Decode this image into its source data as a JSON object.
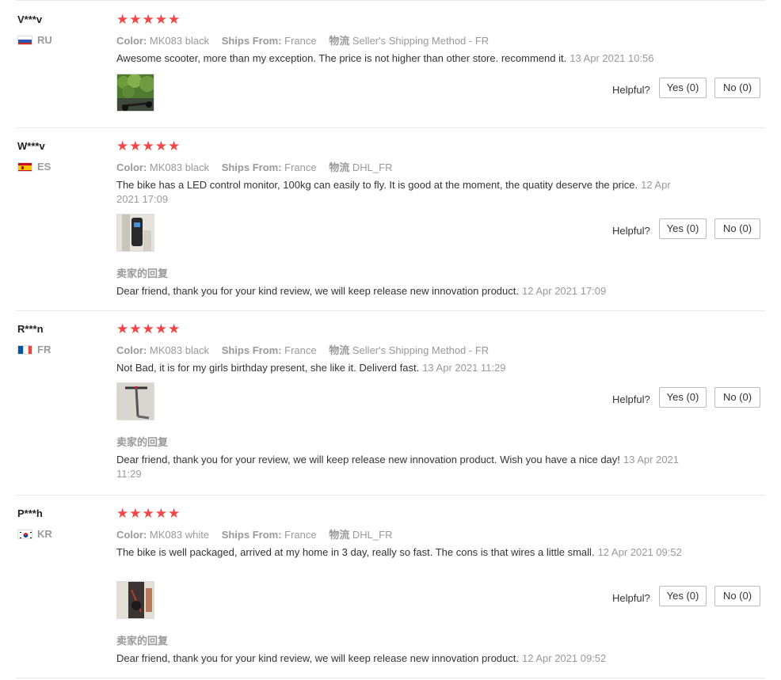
{
  "labels": {
    "color": "Color:",
    "ships_from": "Ships From:",
    "logistics": "物流",
    "helpful": "Helpful?",
    "yes": "Yes (0)",
    "no": "No (0)",
    "seller_reply_title": "卖家的回复"
  },
  "rating_stars": "★★★★★",
  "reviews": [
    {
      "user": "V***v",
      "country": "RU",
      "flag_icon": "russia-flag-icon",
      "color_value": "MK083 black",
      "ships_from_value": "France",
      "logistics_value": "Seller's Shipping Method - FR",
      "text": "Awesome scooter, more than my exception. The price is not higher than other store. recommend it.",
      "date": "13 Apr 2021 10:56"
    },
    {
      "user": "W***v",
      "country": "ES",
      "flag_icon": "spain-flag-icon",
      "color_value": "MK083 black",
      "ships_from_value": "France",
      "logistics_value": "DHL_FR",
      "text": "The bike has a LED control monitor, 100kg can easily to fly. It is good at the moment, the quatity deserve the price.",
      "date": "12 Apr 2021 17:09",
      "reply_text": "Dear friend, thank you for your kind review, we will keep release new innovation product.",
      "reply_date": "12 Apr 2021 17:09"
    },
    {
      "user": "R***n",
      "country": "FR",
      "flag_icon": "france-flag-icon",
      "color_value": "MK083 black",
      "ships_from_value": "France",
      "logistics_value": "Seller's Shipping Method - FR",
      "text": "Not Bad, it is for my girls birthday present, she like it. Deliverd fast.",
      "date": "13 Apr 2021 11:29",
      "reply_text": "Dear friend, thank you for your review, we will keep release new innovation product. Wish you have a nice day!",
      "reply_date": "13 Apr 2021 11:29"
    },
    {
      "user": "P***h",
      "country": "KR",
      "flag_icon": "south-korea-flag-icon",
      "color_value": "MK083 white",
      "ships_from_value": "France",
      "logistics_value": "DHL_FR",
      "text": "The bike is well packaged, arrived at my home in 3 day, really so fast. The cons is that wires a little small.",
      "date": "12 Apr 2021 09:52",
      "reply_text": "Dear friend, thank you for your kind review, we will keep release new innovation product.",
      "reply_date": "12 Apr 2021 09:52"
    }
  ]
}
